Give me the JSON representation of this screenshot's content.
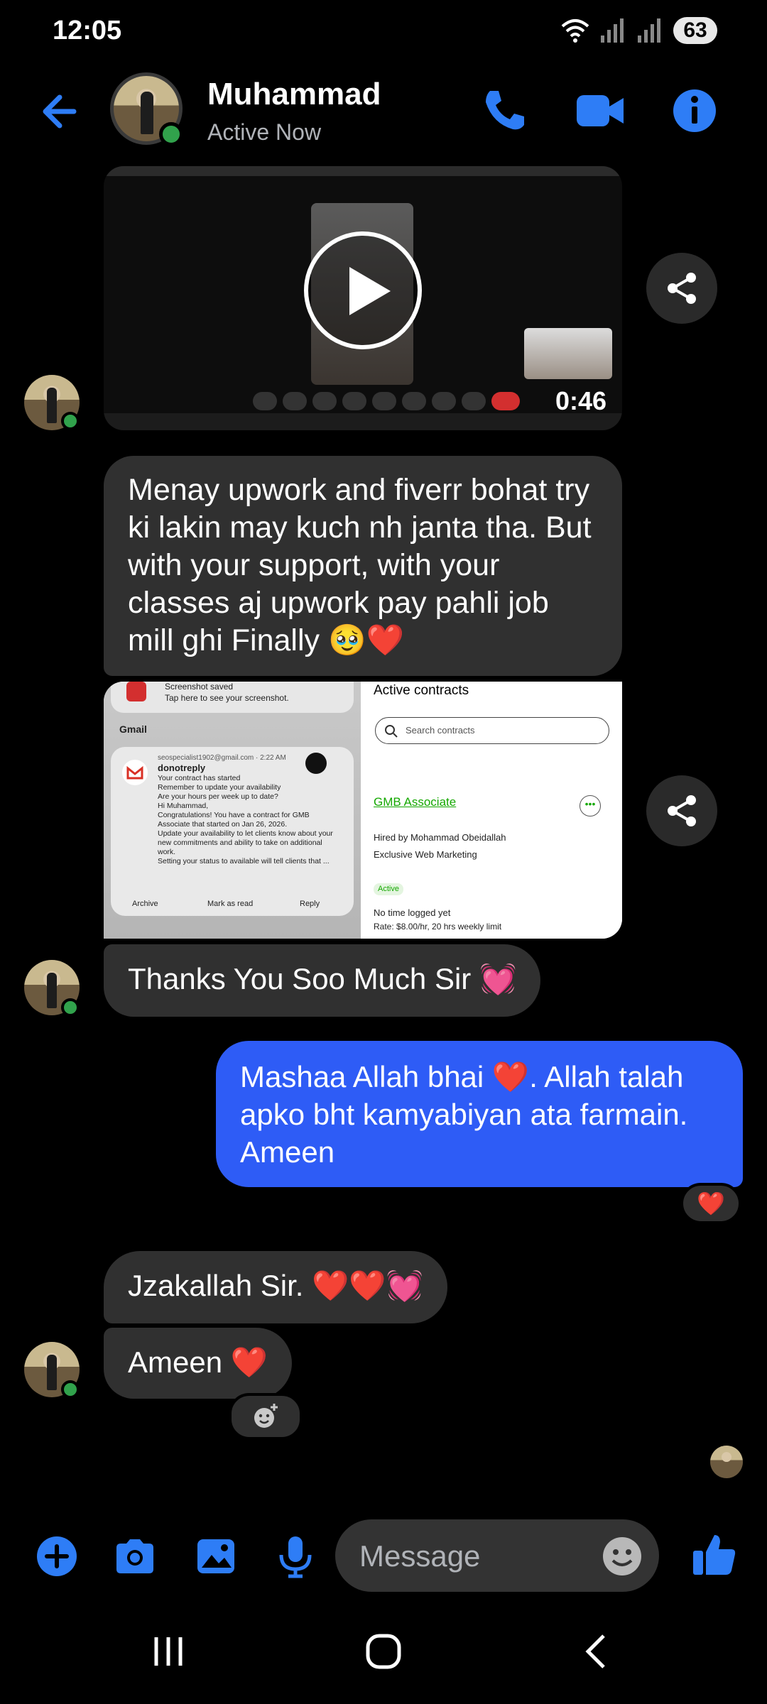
{
  "status_bar": {
    "time": "12:05",
    "battery": "63"
  },
  "header": {
    "name": "Muhammad",
    "presence": "Active Now",
    "icons": [
      "back-arrow-icon",
      "phone-icon",
      "video-camera-icon",
      "info-icon"
    ]
  },
  "messages": {
    "video": {
      "duration": "0:46",
      "icon": "play-icon"
    },
    "text1": "Menay upwork and fiverr bohat try ki lakin may kuch nh janta tha. But with your support, with your classes aj upwork pay pahli job mill ghi Finally 🥹❤️",
    "screenshot": {
      "left": {
        "notif_title": "Screenshot saved",
        "notif_sub": "Tap here to see your screenshot.",
        "app_label": "Gmail",
        "sender": "donotreply",
        "account": "seospecialist1902@gmail.com · 2:22 AM",
        "body": "Your contract has started\nRemember to update your availability\nAre your hours per week up to date?\nHi Muhammad,\nCongratulations! You have a contract for GMB Associate that started on Jan 26, 2026.\nUpdate your availability to let clients know about your new commitments and ability to take on additional work.\nSetting your status to available will tell clients that ...",
        "actions": [
          "Archive",
          "Mark as read",
          "Reply"
        ]
      },
      "right": {
        "title": "Active contracts",
        "search_placeholder": "Search contracts",
        "contract_title": "GMB Associate",
        "hired_by": "Hired by Mohammad Obeidallah",
        "company": "Exclusive Web Marketing",
        "status": "Active",
        "time_logged": "No time logged yet",
        "rate": "Rate: $8.00/hr, 20 hrs weekly limit"
      }
    },
    "text2": "Thanks You Soo Much Sir 💓",
    "outgoing": "Mashaa Allah bhai ❤️. Allah talah apko bht kamyabiyan ata farmain. Ameen",
    "outgoing_reaction": "❤️",
    "text3": "Jzakallah Sir. ❤️❤️💓",
    "text4": "Ameen ❤️"
  },
  "composer": {
    "placeholder": "Message",
    "icons": [
      "plus-icon",
      "camera-icon",
      "gallery-icon",
      "mic-icon",
      "emoji-icon",
      "thumbs-up-icon"
    ]
  },
  "colors": {
    "accent": "#2e5cf6",
    "incoming_bubble": "#303030",
    "online": "#31a24c"
  }
}
